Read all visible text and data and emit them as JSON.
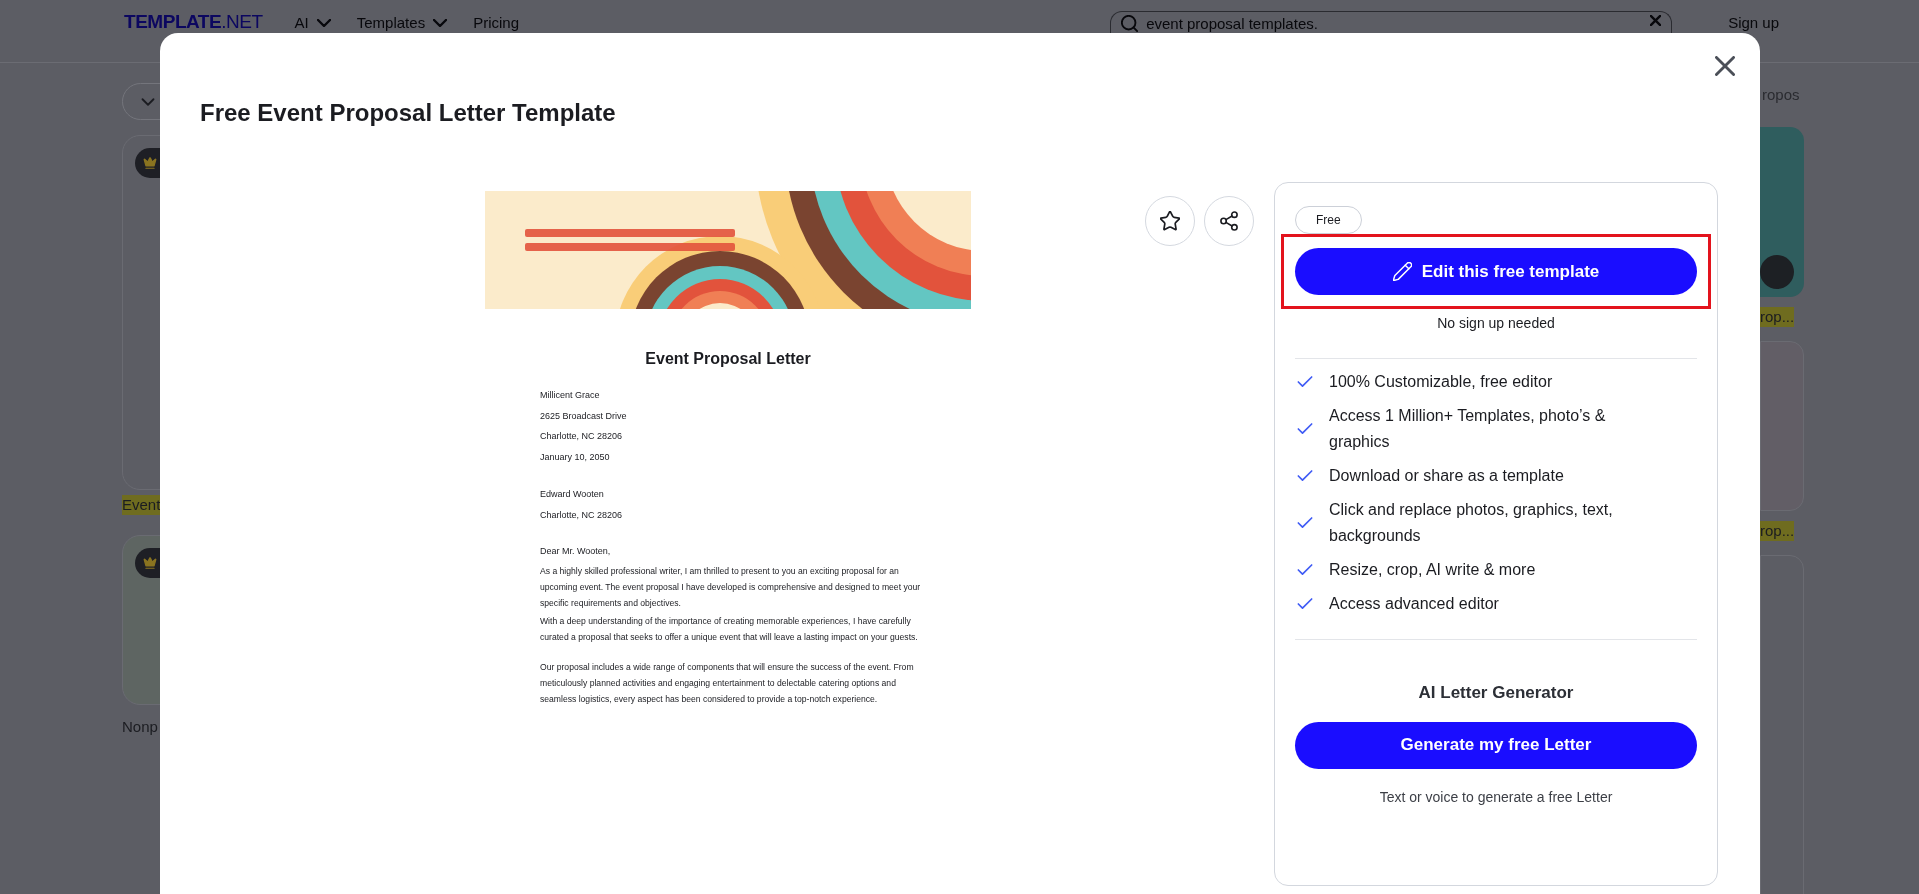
{
  "nav": {
    "logo": "**TEMPLATE**.NET",
    "items": [
      {
        "label": "AI",
        "dropdown": true
      },
      {
        "label": "Templates",
        "dropdown": true
      },
      {
        "label": "Pricing",
        "dropdown": false
      }
    ],
    "search": {
      "value": "event proposal templates."
    },
    "sign_up": "Sign up"
  },
  "background": {
    "left_labels": [
      "Event",
      "Nonp"
    ],
    "right_title": "ropos",
    "right_labels": [
      "rop...",
      "rop..."
    ]
  },
  "modal": {
    "title": "Free Event Proposal Letter Template",
    "letter": {
      "title": "Event Proposal Letter",
      "sender": [
        "Millicent Grace",
        "2625 Broadcast Drive",
        "Charlotte, NC 28206",
        "January 10, 2050"
      ],
      "recipient": [
        "Edward Wooten",
        "Charlotte, NC 28206"
      ],
      "salutation": "Dear Mr. Wooten,",
      "paragraphs": [
        "As a highly skilled professional writer, I am thrilled to present to you an exciting proposal for an upcoming event. The event proposal I have developed is comprehensive and designed to meet your specific requirements and objectives.",
        "With a deep understanding of the importance of creating memorable experiences, I have carefully curated a proposal that seeks to offer a unique event that will leave a lasting impact on your guests.",
        "Our proposal includes a wide range of components that will ensure the success of the event. From meticulously planned activities and engaging entertainment to delectable catering options and seamless logistics, every aspect has been considered to provide a top-notch experience."
      ]
    },
    "panel": {
      "badge": "Free",
      "edit_button": {
        "label": "Edit this free template",
        "annotated": true
      },
      "edit_note": "No sign up needed",
      "features": [
        "100% Customizable, free editor",
        "Access 1 Million+ Templates, photo’s & graphics",
        "Download or share as a template",
        "Click and replace photos, graphics, text, backgrounds",
        "Resize, crop, AI write & more",
        "Access advanced editor"
      ],
      "generator_title": "AI Letter Generator",
      "generate_button": "Generate my free Letter",
      "generator_note": "Text or voice to generate a free Letter"
    }
  }
}
